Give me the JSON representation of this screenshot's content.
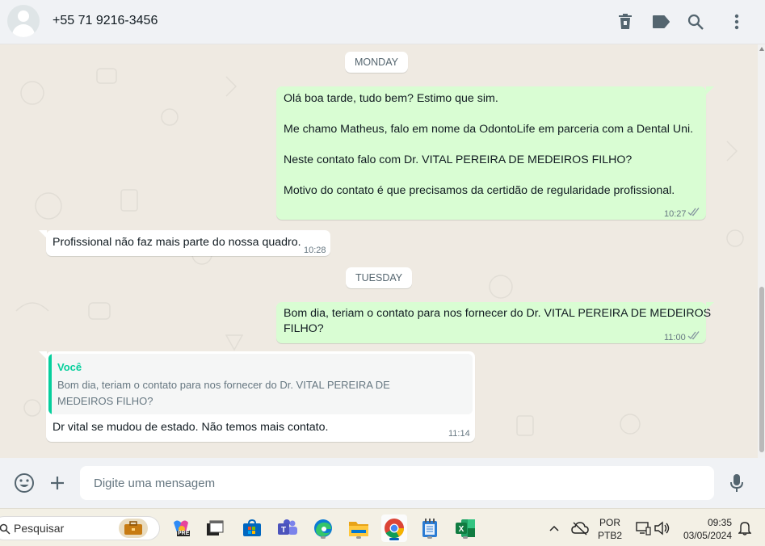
{
  "header": {
    "contact_name": "+55 71 9216-3456",
    "icons": [
      "delete-icon",
      "label-icon",
      "search-icon",
      "menu-icon"
    ]
  },
  "chat": {
    "day1": "MONDAY",
    "day2": "TUESDAY",
    "msg1": {
      "lines": [
        "Olá boa tarde, tudo bem? Estimo que sim.",
        "Me chamo Matheus, falo em nome da OdontoLife em parceria com a Dental Uni.",
        "Neste contato falo com Dr. VITAL PEREIRA DE MEDEIROS FILHO?",
        "Motivo do contato é que precisamos da certidão de regularidade profissional."
      ],
      "time": "10:27",
      "status": "read"
    },
    "msg2": {
      "text": "Profissional não faz mais parte do nossa quadro.",
      "time": "10:28"
    },
    "msg3": {
      "line1": "Bom dia, teriam o contato para nos fornecer do Dr. VITAL PEREIRA DE MEDEIROS",
      "line2": "FILHO?",
      "time": "11:00",
      "status": "read"
    },
    "msg4": {
      "quote_author": "Você",
      "quote_text": "Bom dia, teriam o contato para nos fornecer do Dr. VITAL PEREIRA DE MEDEIROS FILHO?",
      "text": "Dr vital se mudou de estado. Não temos mais contato.",
      "time": "11:14"
    }
  },
  "composer": {
    "placeholder": "Digite uma mensagem",
    "icons": [
      "emoji-icon",
      "plus-icon",
      "microphone-icon"
    ]
  },
  "taskbar": {
    "search_label": "Pesquisar",
    "apps": [
      "briefcase-icon",
      "copilot-icon",
      "window-icon",
      "store-icon",
      "teams-icon",
      "edge-icon",
      "file-explorer-icon",
      "chrome-icon",
      "notepad-icon",
      "excel-icon"
    ],
    "badge_pre": "PRE",
    "lang_top": "POR",
    "lang_bottom": "PTB2",
    "time": "09:35",
    "date": "03/05/2024"
  },
  "colors": {
    "outgoing_bubble": "#d9fdd3",
    "incoming_bubble": "#ffffff",
    "chat_background": "#efeae2",
    "quote_accent": "#06cf9c",
    "read_ticks": "#8696a0"
  }
}
